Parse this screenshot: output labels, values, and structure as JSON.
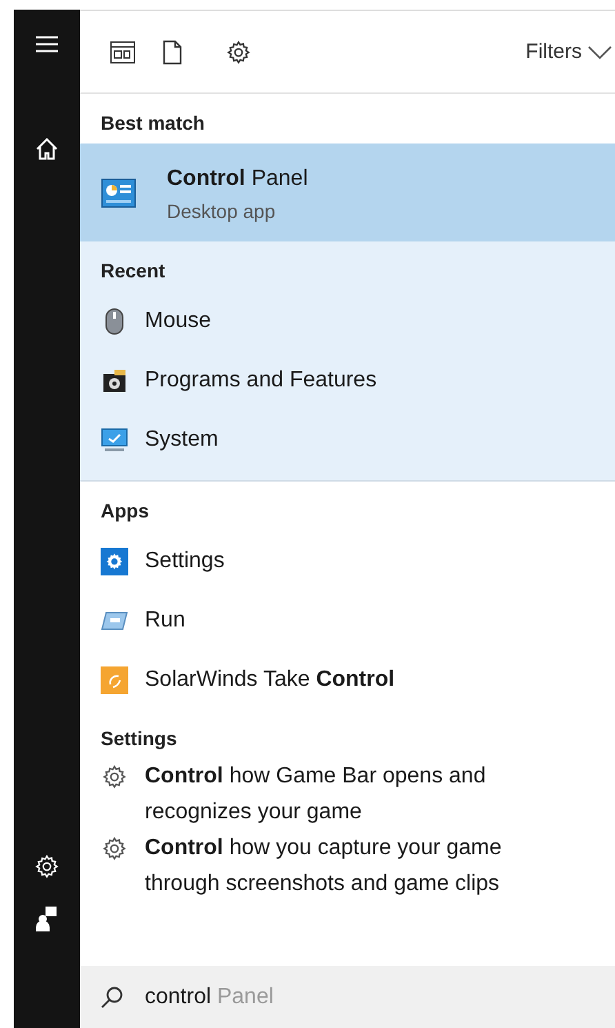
{
  "toolbar": {
    "filters": "Filters"
  },
  "sections": [
    {
      "title": "Best match",
      "highlighted": false,
      "items": [
        {
          "title": "**Control** Panel",
          "subtitle": "Desktop app",
          "selected": true
        }
      ]
    },
    {
      "title": "Recent",
      "highlighted": true,
      "items": [
        {
          "title": "Mouse",
          "selected": false
        },
        {
          "title": "Programs and Features",
          "selected": false
        },
        {
          "title": "System",
          "selected": false
        }
      ]
    },
    {
      "title": "Apps",
      "highlighted": false,
      "items": [
        {
          "title": "Settings",
          "selected": false
        },
        {
          "title": "Run",
          "selected": false
        },
        {
          "title": "SolarWinds Take **Control**",
          "selected": false
        }
      ]
    },
    {
      "title": "Settings",
      "highlighted": false,
      "items": [
        {
          "title": "**Control** how Game Bar opens and recognizes your game",
          "selected": false
        },
        {
          "title": "**Control** how you capture your game through screenshots and game clips",
          "selected": false
        }
      ]
    }
  ],
  "search": {
    "value": "control",
    "suggestion": "Panel"
  }
}
